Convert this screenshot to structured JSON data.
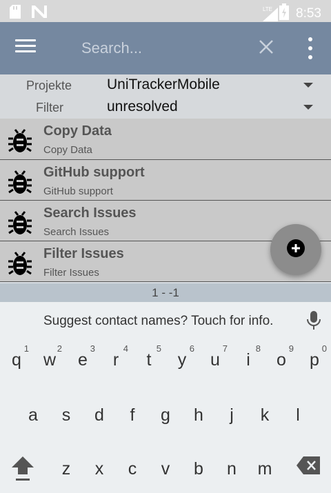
{
  "status_bar": {
    "time": "8:53",
    "network_label": "LTE"
  },
  "toolbar": {
    "search_placeholder": "Search..."
  },
  "filters": [
    {
      "label": "Projekte",
      "value": "UniTrackerMobile"
    },
    {
      "label": "Filter",
      "value": "unresolved"
    }
  ],
  "issues": [
    {
      "title": "Copy Data",
      "subtitle": "Copy Data"
    },
    {
      "title": "GitHub support",
      "subtitle": "GitHub support"
    },
    {
      "title": "Search Issues",
      "subtitle": "Search Issues"
    },
    {
      "title": "Filter Issues",
      "subtitle": "Filter Issues"
    }
  ],
  "pager": {
    "range": "1 - -1"
  },
  "keyboard": {
    "suggestion": "Suggest contact names? Touch for info.",
    "row1": [
      {
        "key": "q",
        "hint": "1"
      },
      {
        "key": "w",
        "hint": "2"
      },
      {
        "key": "e",
        "hint": "3"
      },
      {
        "key": "r",
        "hint": "4"
      },
      {
        "key": "t",
        "hint": "5"
      },
      {
        "key": "y",
        "hint": "6"
      },
      {
        "key": "u",
        "hint": "7"
      },
      {
        "key": "i",
        "hint": "8"
      },
      {
        "key": "o",
        "hint": "9"
      },
      {
        "key": "p",
        "hint": "0"
      }
    ],
    "row2": [
      "a",
      "s",
      "d",
      "f",
      "g",
      "h",
      "j",
      "k",
      "l"
    ],
    "row3": [
      "z",
      "x",
      "c",
      "v",
      "b",
      "n",
      "m"
    ]
  },
  "colors": {
    "toolbar": "#7588a0",
    "fab": "#8c8c8c",
    "list_item": "#c9c9c9"
  }
}
